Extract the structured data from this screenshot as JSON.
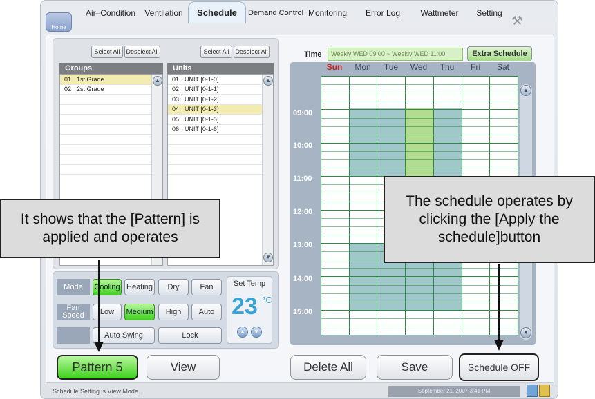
{
  "nav": {
    "home": "Home",
    "tabs": [
      "Air–Condition",
      "Ventilation",
      "Schedule",
      "Demand Control",
      "Monitoring",
      "Error Log",
      "Wattmeter",
      "Setting"
    ]
  },
  "groups": {
    "select_all": "Select All",
    "deselect_all": "Deselect All",
    "header": "Groups",
    "rows": [
      {
        "num": "01",
        "name": "1st Grade",
        "selected": true
      },
      {
        "num": "02",
        "name": "2st Grade",
        "selected": false
      }
    ]
  },
  "units": {
    "select_all": "Select All",
    "deselect_all": "Deselect All",
    "header": "Units",
    "rows": [
      {
        "num": "01",
        "name": "UNIT [0-1-0]"
      },
      {
        "num": "02",
        "name": "UNIT [0-1-1]"
      },
      {
        "num": "03",
        "name": "UNIT [0-1-2]"
      },
      {
        "num": "04",
        "name": "UNIT [0-1-3]",
        "selected": true
      },
      {
        "num": "05",
        "name": "UNIT [0-1-5]"
      },
      {
        "num": "06",
        "name": "UNIT [0-1-6]"
      }
    ]
  },
  "control": {
    "mode_label": "Mode",
    "modes": [
      "Cooling",
      "Heating",
      "Dry",
      "Fan"
    ],
    "active_mode": "Cooling",
    "fan_label": "Fan Speed",
    "fans": [
      "Low",
      "Medium",
      "High",
      "Auto"
    ],
    "active_fan": "Medium",
    "auto_swing": "Auto Swing",
    "lock": "Lock",
    "set_temp_label": "Set Temp",
    "set_temp": "23",
    "unit": "°C"
  },
  "schedule": {
    "time_label": "Time",
    "time_value": "Weekly WED 09:00 ~ Weekly WED 11:00",
    "extra": "Extra Schedule",
    "days": [
      "Sun",
      "Mon",
      "Tue",
      "Wed",
      "Thu",
      "Fri",
      "Sat"
    ],
    "times": [
      "09:00",
      "10:00",
      "11:00",
      "12:00",
      "13:00",
      "14:00",
      "15:00"
    ]
  },
  "buttons": {
    "pattern": "Pattern 5",
    "view": "View",
    "delete_all": "Delete All",
    "save": "Save",
    "schedule_off": "Schedule OFF"
  },
  "status": {
    "mode_text": "Schedule Setting is View Mode.",
    "datetime": "September 21, 2007 3:41 PM"
  },
  "callouts": {
    "left": "It shows that the [Pattern] is applied and operates",
    "right": "The schedule operates by clicking the [Apply the schedule]button"
  },
  "colors": {
    "active_green": "#3ed11e",
    "sunday_red": "#cc1f1f",
    "schedule_block": "#8fbdbf",
    "selected_block": "#b5df86"
  }
}
